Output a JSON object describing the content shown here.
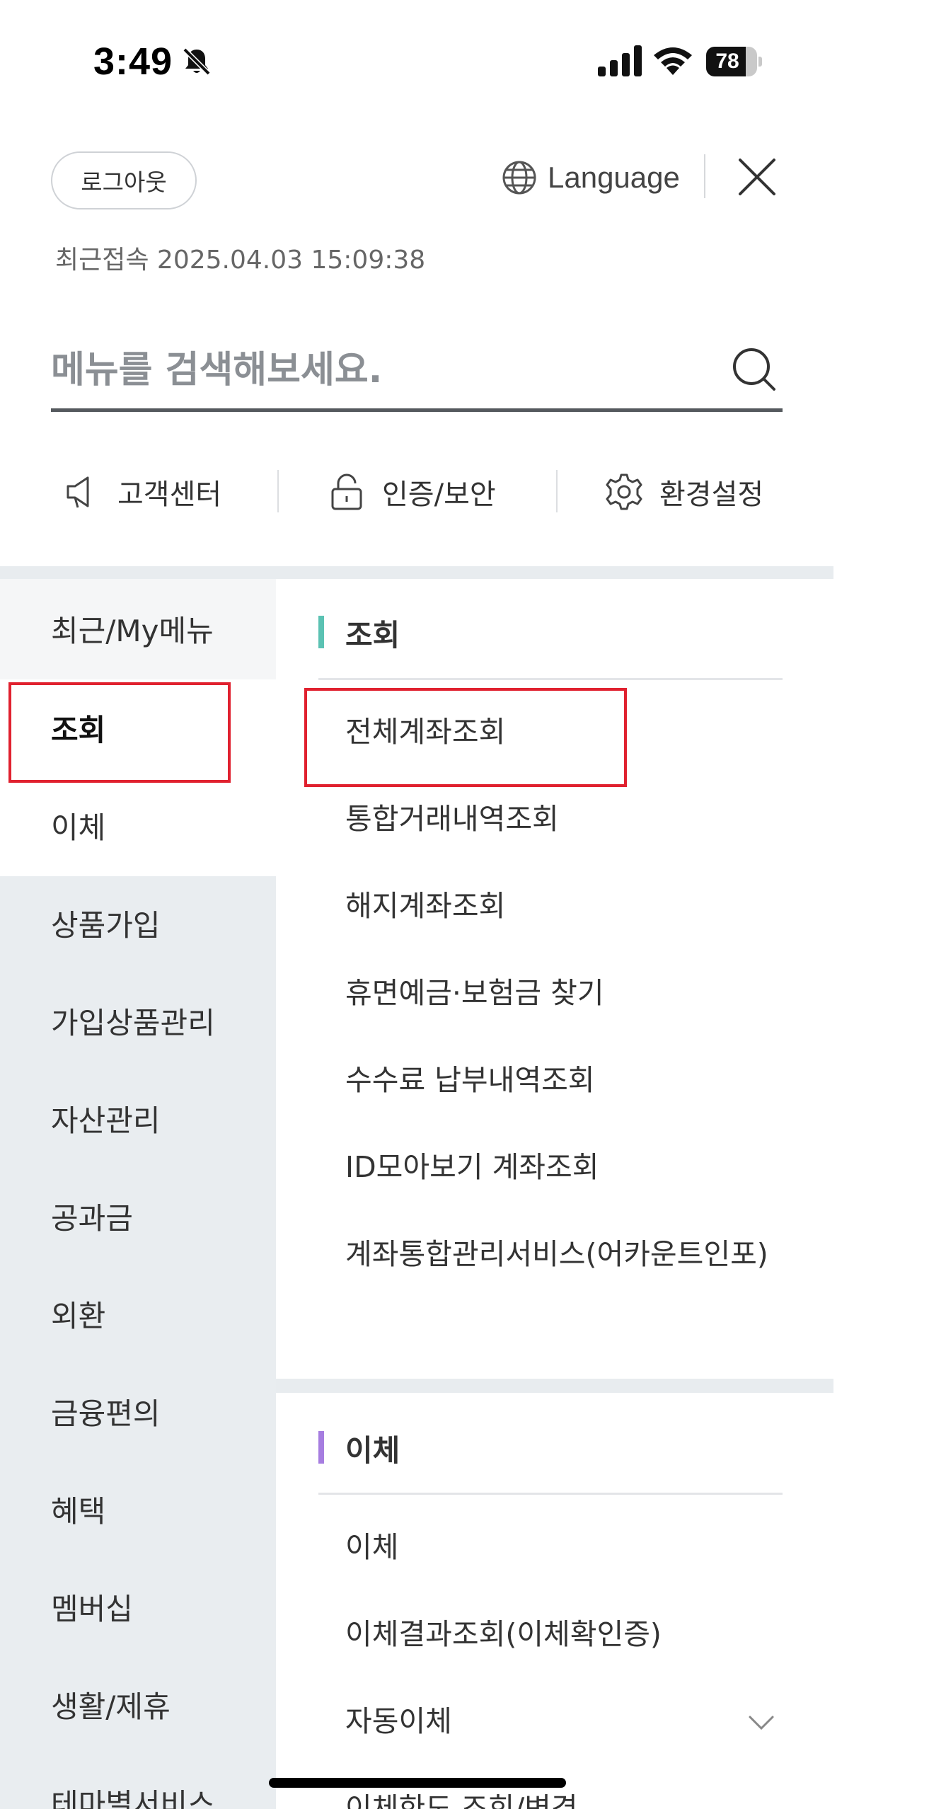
{
  "status_bar": {
    "time": "3:49",
    "battery": "78",
    "battery_level": 0.78
  },
  "header": {
    "logout_label": "로그아웃",
    "language_label": "Language",
    "last_login": "최근접속 2025.04.03 15:09:38"
  },
  "search": {
    "placeholder": "메뉴를 검색해보세요."
  },
  "quick_menu": [
    {
      "label": "고객센터",
      "icon": "megaphone-icon"
    },
    {
      "label": "인증/보안",
      "icon": "lock-icon"
    },
    {
      "label": "환경설정",
      "icon": "gear-icon"
    }
  ],
  "sidebar": {
    "items": [
      {
        "label": "최근/My메뉴"
      },
      {
        "label": "조회"
      },
      {
        "label": "이체"
      },
      {
        "label": "상품가입"
      },
      {
        "label": "가입상품관리"
      },
      {
        "label": "자산관리"
      },
      {
        "label": "공과금"
      },
      {
        "label": "외환"
      },
      {
        "label": "금융편의"
      },
      {
        "label": "혜택"
      },
      {
        "label": "멤버십"
      },
      {
        "label": "생활/제휴"
      },
      {
        "label": "테마별서비스"
      }
    ],
    "active_index": 1
  },
  "sections": [
    {
      "title": "조회",
      "accent": "#5bc2b3",
      "items": [
        {
          "label": "전체계좌조회"
        },
        {
          "label": "통합거래내역조회"
        },
        {
          "label": "해지계좌조회"
        },
        {
          "label": "휴면예금·보험금 찾기"
        },
        {
          "label": "수수료 납부내역조회"
        },
        {
          "label": "ID모아보기 계좌조회"
        },
        {
          "label": "계좌통합관리서비스(어카운트인포)"
        }
      ]
    },
    {
      "title": "이체",
      "accent": "#a67de0",
      "items": [
        {
          "label": "이체"
        },
        {
          "label": "이체결과조회(이체확인증)"
        },
        {
          "label": "자동이체"
        },
        {
          "label": "이체한도 조회/변경"
        }
      ]
    }
  ],
  "highlight_color": "#e0212f"
}
